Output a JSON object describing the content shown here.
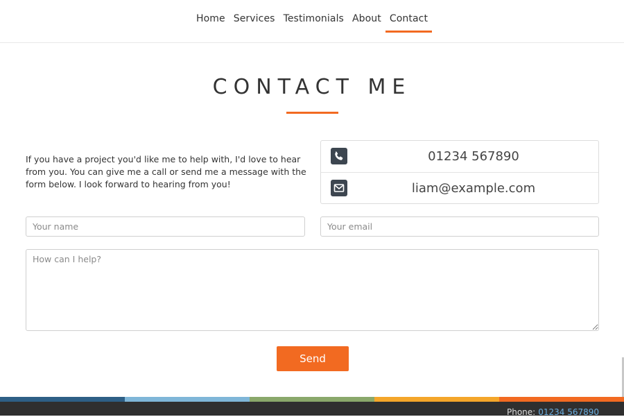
{
  "nav": {
    "items": [
      {
        "label": "Home"
      },
      {
        "label": "Services"
      },
      {
        "label": "Testimonials"
      },
      {
        "label": "About"
      },
      {
        "label": "Contact",
        "active": true
      }
    ]
  },
  "page": {
    "title": "CONTACT ME",
    "intro": "If you have a project you'd like me to help with, I'd love to hear from you. You can give me a call or send me a message with the form below. I look forward to hearing from you!"
  },
  "contact": {
    "phone": "01234 567890",
    "email": "liam@example.com",
    "phone_icon": "phone-icon",
    "email_icon": "envelope-icon"
  },
  "form": {
    "name_placeholder": "Your name",
    "email_placeholder": "Your email",
    "message_placeholder": "How can I help?",
    "send_label": "Send"
  },
  "footer": {
    "phone_label": "Phone:",
    "phone_value": "01234 567890",
    "stripe_colors": [
      "#2e5f86",
      "#7fb6d8",
      "#8aa86b",
      "#f4a62a",
      "#f26a21"
    ]
  },
  "colors": {
    "accent": "#f26a21",
    "icon_bg": "#3d4650",
    "footer_bg": "#2f2f2f"
  }
}
